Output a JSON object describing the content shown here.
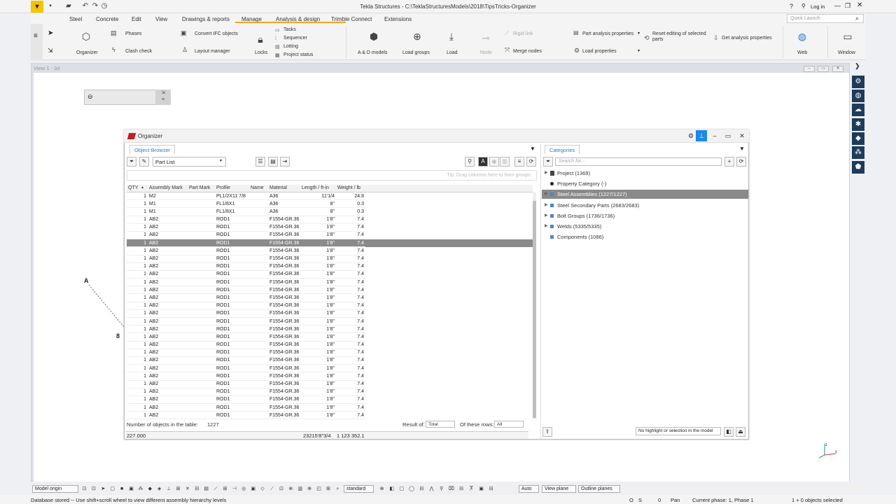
{
  "window": {
    "title": "Tekla Structures - C:\\TeklaStructuresModels\\2018\\TipsTricks-Organizer",
    "login": "Log in",
    "help": "?"
  },
  "menu": [
    "Steel",
    "Concrete",
    "Edit",
    "View",
    "Drawings & reports",
    "Manage",
    "Analysis & design",
    "Trimble Connect",
    "Extensions"
  ],
  "quick_launch_placeholder": "Quick Launch",
  "ribbon": {
    "organizer": "Organizer",
    "phases": "Phases",
    "clash_check": "Clash check",
    "convert_ifc": "Convert IFC objects",
    "layout_manager": "Layout manager",
    "locks": "Locks",
    "tasks": "Tasks",
    "sequencer": "Sequencer",
    "lotting": "Lotting",
    "project_status": "Project status",
    "ad_models": "A & D models",
    "load_groups": "Load groups",
    "load": "Load",
    "node": "Node",
    "rigid_link": "Rigid link",
    "merge_nodes": "Merge nodes",
    "part_analysis_properties": "Part analysis properties",
    "load_properties": "Load properties",
    "reset_editing": "Reset editing of selected parts",
    "get_analysis_properties": "Get analysis properties",
    "web": "Web",
    "window": "Window"
  },
  "view": {
    "title": "View 1 - 3d",
    "label_a": "A",
    "label_8": "8"
  },
  "organizer": {
    "title": "Organizer",
    "tab_object_browser": "Object Browser",
    "tab_categories": "Categories",
    "part_list": "Part List",
    "group_hint": "Tip: Drag columns here to form groups.",
    "columns": [
      "QTY",
      "Assembly Mark",
      "Part Mark",
      "Profile",
      "Name",
      "Material",
      "Length / ft-in",
      "Weight / lb"
    ],
    "rows": [
      [
        "1",
        "M2",
        "",
        "PL1/2X11 7/8",
        "",
        "A36",
        "11'1/4",
        "24.8"
      ],
      [
        "1",
        "M1",
        "",
        "FL1/8X1",
        "",
        "A36",
        "8\"",
        "0.3"
      ],
      [
        "1",
        "M1",
        "",
        "FL1/8X1",
        "",
        "A36",
        "8\"",
        "0.3"
      ],
      [
        "1",
        "AB2",
        "",
        "ROD1",
        "",
        "F1554-GR.36",
        "1'8\"",
        "7.4"
      ],
      [
        "1",
        "AB2",
        "",
        "ROD1",
        "",
        "F1554-GR.36",
        "1'8\"",
        "7.4"
      ],
      [
        "1",
        "AB2",
        "",
        "ROD1",
        "",
        "F1554-GR.36",
        "1'8\"",
        "7.4"
      ],
      [
        "1",
        "AB2",
        "",
        "ROD1",
        "",
        "F1554-GR.36",
        "1'8\"",
        "7.4"
      ],
      [
        "1",
        "AB2",
        "",
        "ROD1",
        "",
        "F1554-GR.36",
        "1'8\"",
        "7.4"
      ],
      [
        "1",
        "AB2",
        "",
        "ROD1",
        "",
        "F1554-GR.36",
        "1'8\"",
        "7.4"
      ],
      [
        "1",
        "AB2",
        "",
        "ROD1",
        "",
        "F1554-GR.36",
        "1'8\"",
        "7.4"
      ],
      [
        "1",
        "AB2",
        "",
        "ROD1",
        "",
        "F1554-GR.36",
        "1'8\"",
        "7.4"
      ],
      [
        "1",
        "AB2",
        "",
        "ROD1",
        "",
        "F1554-GR.36",
        "1'8\"",
        "7.4"
      ],
      [
        "1",
        "AB2",
        "",
        "ROD1",
        "",
        "F1554-GR.36",
        "1'8\"",
        "7.4"
      ],
      [
        "1",
        "AB2",
        "",
        "ROD1",
        "",
        "F1554-GR.36",
        "1'8\"",
        "7.4"
      ],
      [
        "1",
        "AB2",
        "",
        "ROD1",
        "",
        "F1554-GR.36",
        "1'8\"",
        "7.4"
      ],
      [
        "1",
        "AB2",
        "",
        "ROD1",
        "",
        "F1554-GR.36",
        "1'8\"",
        "7.4"
      ],
      [
        "1",
        "AB2",
        "",
        "ROD1",
        "",
        "F1554-GR.36",
        "1'8\"",
        "7.4"
      ],
      [
        "1",
        "AB2",
        "",
        "ROD1",
        "",
        "F1554-GR.36",
        "1'8\"",
        "7.4"
      ],
      [
        "1",
        "AB2",
        "",
        "ROD1",
        "",
        "F1554-GR.36",
        "1'8\"",
        "7.4"
      ],
      [
        "1",
        "AB2",
        "",
        "ROD1",
        "",
        "F1554-GR.36",
        "1'8\"",
        "7.4"
      ],
      [
        "1",
        "AB2",
        "",
        "ROD1",
        "",
        "F1554-GR.36",
        "1'8\"",
        "7.4"
      ],
      [
        "1",
        "AB2",
        "",
        "ROD1",
        "",
        "F1554-GR.36",
        "1'8\"",
        "7.4"
      ],
      [
        "1",
        "AB2",
        "",
        "ROD1",
        "",
        "F1554-GR.36",
        "1'8\"",
        "7.4"
      ],
      [
        "1",
        "AB2",
        "",
        "ROD1",
        "",
        "F1554-GR.36",
        "1'8\"",
        "7.4"
      ],
      [
        "1",
        "AB2",
        "",
        "ROD1",
        "",
        "F1554-GR.36",
        "1'8\"",
        "7.4"
      ],
      [
        "1",
        "AB2",
        "",
        "ROD1",
        "",
        "F1554-GR.36",
        "1'8\"",
        "7.4"
      ],
      [
        "1",
        "AB2",
        "",
        "ROD1",
        "",
        "F1554-GR.36",
        "1'8\"",
        "7.4"
      ],
      [
        "1",
        "AB2",
        "",
        "ROD1",
        "",
        "F1554-GR.36",
        "1'8\"",
        "7.4"
      ],
      [
        "1",
        "AB2",
        "",
        "ROD1",
        "",
        "F1554-GR.36",
        "1'8\"",
        "7.4"
      ],
      [
        "1",
        "AB2",
        "",
        "ROD1",
        "",
        "F1554-GR.36",
        "1'8\"",
        "7.4"
      ],
      [
        "1",
        "AB2",
        "",
        "ROD1",
        "",
        "F1554-GR.36",
        "1'8\"",
        "7.4"
      ]
    ],
    "selected_row": 6,
    "footer_label": "Number of objects in the table:",
    "footer_count": "1227",
    "result_of_label": "Result of:",
    "result_of_value": "Total",
    "of_these_rows_label": "Of these rows:",
    "of_these_rows_value": "All",
    "totals": {
      "qty": "227.000",
      "length": "23215'8\"3/4",
      "weight": "1 123 352.1"
    },
    "search_placeholder": "Search for...",
    "categories": [
      {
        "label": "Project (1369)",
        "arrow": true,
        "icon": "folder"
      },
      {
        "label": "Property Category (-)",
        "arrow": false,
        "icon": "dot"
      },
      {
        "label": "Steel Assemblies (1227/1227)",
        "arrow": true,
        "icon": "sq",
        "selected": true
      },
      {
        "label": "Steel Secondary Parts (2683/2683)",
        "arrow": true,
        "icon": "sq"
      },
      {
        "label": "Bolt Groups (1736/1736)",
        "arrow": true,
        "icon": "sq"
      },
      {
        "label": "Welds (5335/5335)",
        "arrow": true,
        "icon": "sq"
      },
      {
        "label": "Components (1086)",
        "arrow": false,
        "icon": "sq"
      }
    ],
    "highlight_option": "No highlight or selection in the model"
  },
  "bottombar": {
    "model_origin": "Model origin",
    "standard": "standard",
    "auto": "Auto",
    "view_plane": "View plane",
    "outline_planes": "Outline planes"
  },
  "status": {
    "message": "Database stored -- Use shift+scroll wheel to view different assembly hierarchy levels",
    "o": "O",
    "s": "S",
    "zero": "0",
    "pan": "Pan",
    "phase": "Current phase: 1, Phase 1",
    "selected": "1 + 0 objects selected"
  },
  "colors": {
    "accent": "#1e88e5",
    "menu_underline": "#f5a623",
    "logo": "#f5c400",
    "selection": "#8a8a8a"
  }
}
